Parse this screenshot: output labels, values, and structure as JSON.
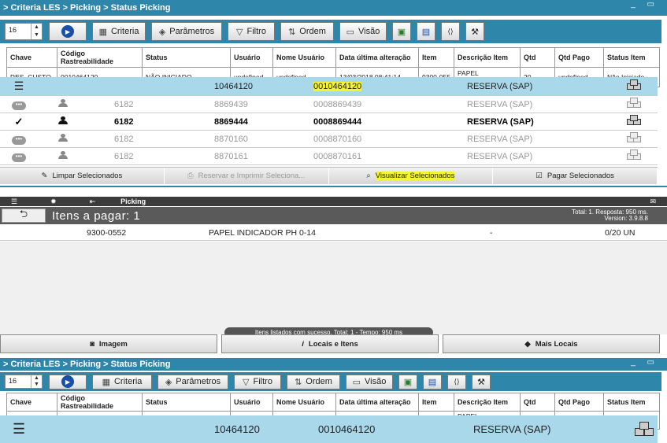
{
  "top": {
    "breadcrumb": "> Criteria LES > Picking > Status Picking",
    "window_controls": "_ ▭",
    "spin_value": "16",
    "toolbar": {
      "criteria": "Criteria",
      "parametros": "Parâmetros",
      "filtro": "Filtro",
      "ordem": "Ordem",
      "visao": "Visão"
    },
    "columns": [
      "Chave",
      "Código Rastreabilidade",
      "Status",
      "Usuário",
      "Nome Usuário",
      "Data última alteração",
      "Item",
      "Descrição Item",
      "Qtd",
      "Qtd Pago",
      "Status Item"
    ],
    "row": [
      "RES_CUSTO",
      "0010464120",
      "NÃO INICIADO",
      "undefined",
      "undefined",
      "13/03/2018 08:41:14",
      "9300-055",
      "PAPEL INDICADOR",
      "20",
      "undefined",
      "Não Iniciado"
    ]
  },
  "picking": {
    "header": {
      "a": "10464120",
      "b": "0010464120",
      "c": "RESERVA (SAP)"
    },
    "rows": [
      {
        "a": "6182",
        "b": "8869439",
        "c": "0008869439",
        "d": "RESERVA (SAP)"
      },
      {
        "a": "6182",
        "b": "8869444",
        "c": "0008869444",
        "d": "RESERVA (SAP)"
      },
      {
        "a": "6182",
        "b": "8870160",
        "c": "0008870160",
        "d": "RESERVA (SAP)"
      },
      {
        "a": "6182",
        "b": "8870161",
        "c": "0008870161",
        "d": "RESERVA (SAP)"
      }
    ],
    "actions": {
      "limpar": "Limpar Selecionados",
      "reservar": "Reservar e Imprimir Seleciona...",
      "visualizar": "Visualizar Selecionados",
      "pagar": "Pagar Selecionados"
    }
  },
  "mobile": {
    "title": "Picking",
    "heading": "Itens a pagar: 1",
    "info_line1": "Total: 1. Resposta: 950 ms.",
    "info_line2": "Version: 3.9.8.8",
    "item": {
      "code": "9300-0552",
      "desc": "PAPEL INDICADOR PH 0-14",
      "dash": "-",
      "qty": "0/20 UN"
    },
    "toast": "Itens listados com sucesso. Total: 1 - Tempo: 950 ms",
    "footer": {
      "imagem": "Imagem",
      "locais": "Locais e Itens",
      "mais": "Mais Locais"
    }
  },
  "bottom": {
    "breadcrumb": "> Criteria LES > Picking > Status Picking",
    "spin_value": "16",
    "band": {
      "a": "10464120",
      "b": "0010464120",
      "c": "RESERVA (SAP)"
    }
  },
  "colors": {
    "blue": "#2e86ab",
    "band": "#a9d8ea",
    "highlight": "#f4f432"
  }
}
